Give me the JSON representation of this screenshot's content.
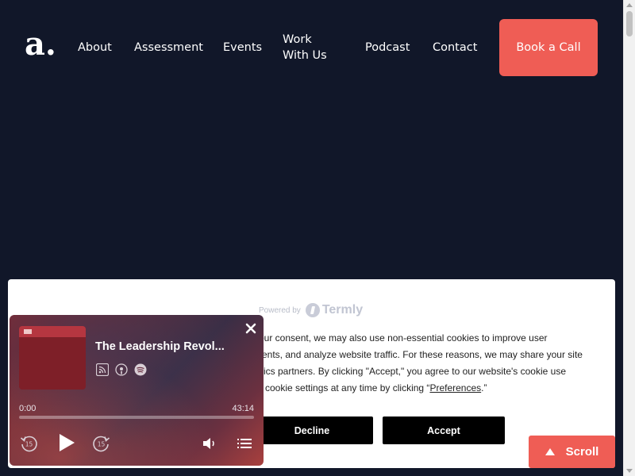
{
  "header": {
    "logo_text": "a.",
    "nav": [
      "About",
      "Assessment",
      "Events",
      "Work With Us",
      "Podcast",
      "Contact"
    ],
    "cta_label": "Book a Call"
  },
  "cookie_banner": {
    "powered_by": "Powered by",
    "brand": "Termly",
    "lines": [
      "your consent, we may also use non-essential cookies to improve user",
      "ments, and analyze website traffic. For these reasons, we may share your site",
      "lytics partners. By clicking \"Accept,\" you agree to our website's cookie use",
      "ur cookie settings at any time by clicking “"
    ],
    "preferences_link": "Preferences",
    "after_link": ".”",
    "decline_label": "Decline",
    "accept_label": "Accept"
  },
  "player": {
    "episode_title": "The Leadership Revol...",
    "current_time": "0:00",
    "duration": "43:14",
    "progress": 0,
    "skip_back_seconds": "15",
    "skip_forward_seconds": "15",
    "subscribe_icons": [
      "rss-icon",
      "apple-podcasts-icon",
      "spotify-icon"
    ]
  },
  "scroll_button": {
    "label": "Scroll"
  },
  "colors": {
    "background": "#111729",
    "accent": "#ef5d55",
    "cookie_bg": "#ffffff",
    "button_dark": "#000000"
  }
}
